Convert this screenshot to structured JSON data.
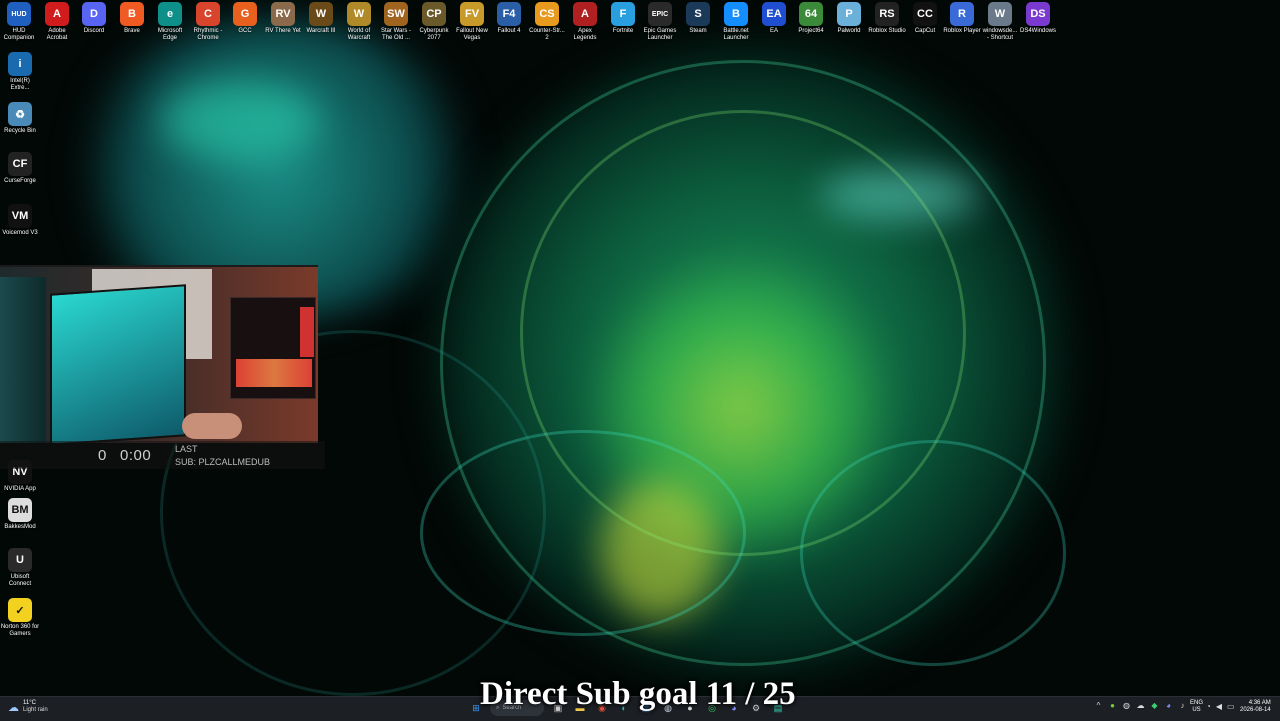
{
  "top_icons": [
    {
      "label": "HUD Companion",
      "icon": "hud-icon",
      "color": "#1f5fbf",
      "text": "HUD"
    },
    {
      "label": "Adobe Acrobat",
      "icon": "acrobat-icon",
      "color": "#d01c1c",
      "text": "A"
    },
    {
      "label": "Discord",
      "icon": "discord-icon",
      "color": "#5865f2",
      "text": "D"
    },
    {
      "label": "Brave",
      "icon": "brave-icon",
      "color": "#f05a23",
      "text": "B"
    },
    {
      "label": "Microsoft Edge",
      "icon": "edge-icon",
      "color": "#0f8f8a",
      "text": "e"
    },
    {
      "label": "Rhythmic - Chrome",
      "icon": "chrome-icon",
      "color": "#d9442d",
      "text": "C"
    },
    {
      "label": "GCC",
      "icon": "gcc-icon",
      "color": "#e8601e",
      "text": "G"
    },
    {
      "label": "RV There Yet",
      "icon": "rv-icon",
      "color": "#8a6a4a",
      "text": "RV"
    },
    {
      "label": "Warcraft III",
      "icon": "warcraft3-icon",
      "color": "#6b4a1a",
      "text": "W"
    },
    {
      "label": "World of Warcraft",
      "icon": "wow-icon",
      "color": "#b08a28",
      "text": "W"
    },
    {
      "label": "Star Wars - The Old ...",
      "icon": "swtor-icon",
      "color": "#a0641e",
      "text": "SW"
    },
    {
      "label": "Cyberpunk 2077",
      "icon": "cyberpunk-icon",
      "color": "#6a5a2a",
      "text": "CP"
    },
    {
      "label": "Fallout New Vegas",
      "icon": "fallout-nv-icon",
      "color": "#c89a2a",
      "text": "FV"
    },
    {
      "label": "Fallout 4",
      "icon": "fallout4-icon",
      "color": "#2a5fa8",
      "text": "F4"
    },
    {
      "label": "Counter-Str... 2",
      "icon": "cs2-icon",
      "color": "#e89a1e",
      "text": "CS"
    },
    {
      "label": "Apex Legends",
      "icon": "apex-icon",
      "color": "#b02020",
      "text": "A"
    },
    {
      "label": "Fortnite",
      "icon": "fortnite-icon",
      "color": "#2a9fe0",
      "text": "F"
    },
    {
      "label": "Epic Games Launcher",
      "icon": "epic-icon",
      "color": "#2a2a2a",
      "text": "EPIC"
    },
    {
      "label": "Steam",
      "icon": "steam-icon",
      "color": "#1b3a5a",
      "text": "S"
    },
    {
      "label": "Battle.net Launcher",
      "icon": "battlenet-icon",
      "color": "#148eff",
      "text": "B"
    },
    {
      "label": "EA",
      "icon": "ea-icon",
      "color": "#1f4fd0",
      "text": "EA"
    },
    {
      "label": "Project64",
      "icon": "project64-icon",
      "color": "#3a8a3a",
      "text": "64"
    },
    {
      "label": "Palworld",
      "icon": "palworld-icon",
      "color": "#6ab0d8",
      "text": "P"
    },
    {
      "label": "Roblox Studio",
      "icon": "roblox-studio-icon",
      "color": "#222222",
      "text": "RS"
    },
    {
      "label": "CapCut",
      "icon": "capcut-icon",
      "color": "#111111",
      "text": "CC"
    },
    {
      "label": "Roblox Player",
      "icon": "roblox-player-icon",
      "color": "#3a6ad8",
      "text": "R"
    },
    {
      "label": "windowsde... - Shortcut",
      "icon": "shortcut-icon",
      "color": "#6a7a8a",
      "text": "W"
    },
    {
      "label": "DS4Windows",
      "icon": "ds4windows-icon",
      "color": "#7a3ad0",
      "text": "DS"
    }
  ],
  "left_icons": [
    {
      "label": "Intel(R) Extre...",
      "icon": "intel-icon",
      "color": "#1a6ab0",
      "text": "i"
    },
    {
      "label": "Recycle Bin",
      "icon": "recycle-bin-icon",
      "color": "#4a8ab8",
      "text": "♻"
    },
    {
      "label": "CurseForge",
      "icon": "curseforge-icon",
      "color": "#222222",
      "text": "CF"
    },
    {
      "label": "Voicemod V3",
      "icon": "voicemod-icon",
      "color": "#111111",
      "text": "VM"
    },
    {
      "label": "NVIDIA App",
      "icon": "nvidia-icon",
      "color": "#111111",
      "text": "NV"
    },
    {
      "label": "BakkesMod",
      "icon": "bakkesmod-icon",
      "color": "#dddddd",
      "text": "BM"
    },
    {
      "label": "Ubisoft Connect",
      "icon": "ubisoft-icon",
      "color": "#2a2a2a",
      "text": "U"
    },
    {
      "label": "Norton 360 for Gamers",
      "icon": "norton-icon",
      "color": "#f2d21e",
      "text": "✓"
    }
  ],
  "stream_overlay": {
    "sub_count": "0",
    "timer": "0:00",
    "last_label": "LAST",
    "last_sub": "SUB: PLZCALLMEDUB"
  },
  "subtitle": "Direct Sub goal 11 / 25",
  "taskbar": {
    "temperature": "11°C",
    "condition": "Light rain",
    "search_placeholder": "Search",
    "language": "ENG",
    "region": "US",
    "time": "4:36 AM",
    "date": "2026-08-14"
  },
  "colors": {
    "wallpaper_glow": "#2de0a8",
    "wallpaper_yellow": "#d8e83a",
    "taskbar_bg": "#1c1f24"
  }
}
